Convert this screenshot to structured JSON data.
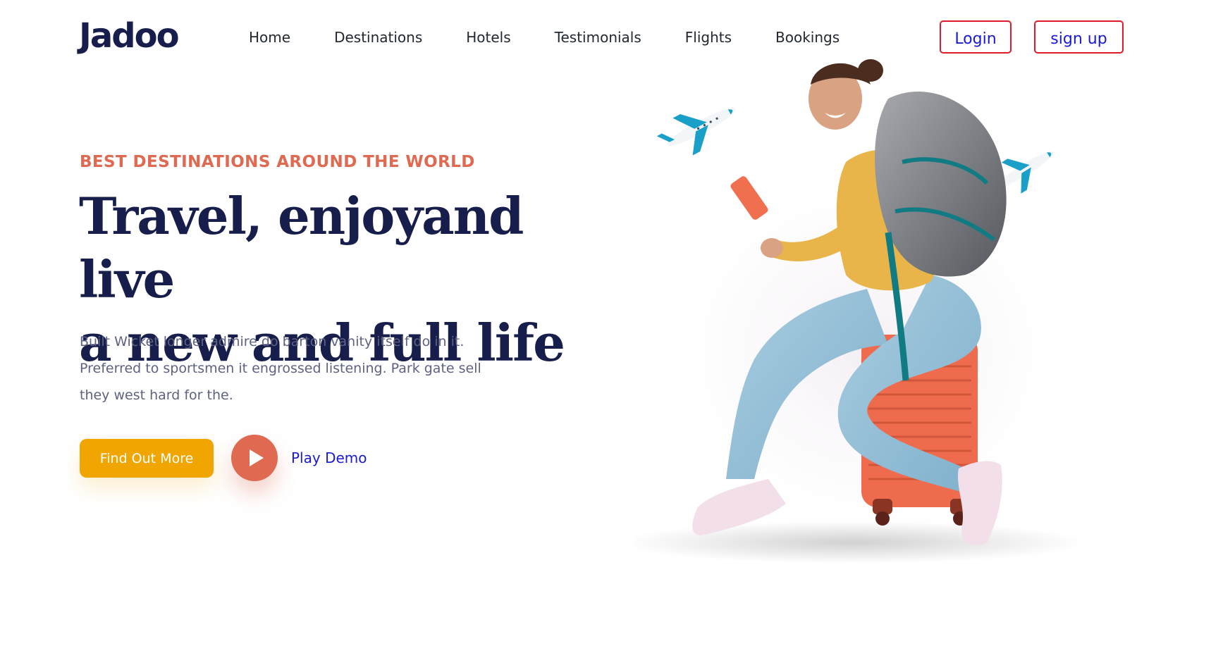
{
  "brand": {
    "logo_text": "Jadoo"
  },
  "nav": {
    "items": [
      {
        "label": "Home"
      },
      {
        "label": "Destinations"
      },
      {
        "label": "Hotels"
      },
      {
        "label": "Testimonials"
      },
      {
        "label": "Flights"
      },
      {
        "label": "Bookings"
      }
    ],
    "login_label": "Login",
    "signup_label": "sign up"
  },
  "hero": {
    "eyebrow": "BEST DESTINATIONS AROUND THE WORLD",
    "headline_line1": "Travel, enjoyand live",
    "headline_line2": "a new and full life",
    "body": "Built Wicket longer admire do barton vanity itself do in it. Preferred to sportsmen it engrossed listening. Park gate sell they west hard for the.",
    "cta_label": "Find Out More",
    "play_label": "Play Demo"
  },
  "colors": {
    "primary_navy": "#181e4b",
    "accent_orange": "#df6951",
    "accent_yellow": "#f1a501",
    "link_blue": "#1a1ad9",
    "button_border_red": "#e01a2b",
    "body_gray": "#5e6282"
  },
  "icons": {
    "play": "play-icon",
    "plane": "airplane-icon"
  }
}
